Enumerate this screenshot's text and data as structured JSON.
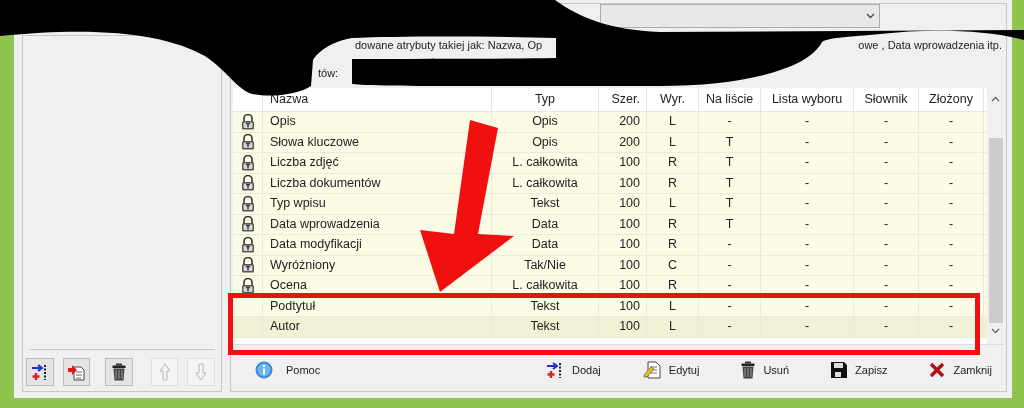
{
  "description_fragments": [
    "dowane atrybuty takiej jak: Nazwa, Op",
    "owe , Data wprowadzenia itp."
  ],
  "list_label": "tów:",
  "table": {
    "columns": [
      "Nazwa",
      "Typ",
      "Szer.",
      "Wyr.",
      "Na liście",
      "Lista wyboru",
      "Słownik",
      "Złożony"
    ],
    "rows": [
      {
        "locked": true,
        "selected": false,
        "cells": [
          "Opis",
          "Opis",
          "200",
          "L",
          "-",
          "-",
          "-",
          "-"
        ]
      },
      {
        "locked": true,
        "selected": false,
        "cells": [
          "Słowa kluczowe",
          "Opis",
          "200",
          "L",
          "T",
          "-",
          "-",
          "-"
        ]
      },
      {
        "locked": true,
        "selected": false,
        "cells": [
          "Liczba zdjęć",
          "L. całkowita",
          "100",
          "R",
          "T",
          "-",
          "-",
          "-"
        ]
      },
      {
        "locked": true,
        "selected": false,
        "cells": [
          "Liczba dokumentów",
          "L. całkowita",
          "100",
          "R",
          "T",
          "-",
          "-",
          "-"
        ]
      },
      {
        "locked": true,
        "selected": false,
        "cells": [
          "Typ wpisu",
          "Tekst",
          "100",
          "L",
          "T",
          "-",
          "-",
          "-"
        ]
      },
      {
        "locked": true,
        "selected": false,
        "cells": [
          "Data wprowadzenia",
          "Data",
          "100",
          "R",
          "T",
          "-",
          "-",
          "-"
        ]
      },
      {
        "locked": true,
        "selected": false,
        "cells": [
          "Data modyfikacji",
          "Data",
          "100",
          "R",
          "-",
          "-",
          "-",
          "-"
        ]
      },
      {
        "locked": true,
        "selected": false,
        "cells": [
          "Wyróżniony",
          "Tak/Nie",
          "100",
          "C",
          "-",
          "-",
          "-",
          "-"
        ]
      },
      {
        "locked": true,
        "selected": false,
        "cells": [
          "Ocena",
          "L. całkowita",
          "100",
          "R",
          "-",
          "-",
          "-",
          "-"
        ]
      },
      {
        "locked": false,
        "selected": false,
        "cells": [
          "Podtytuł",
          "Tekst",
          "100",
          "L",
          "-",
          "-",
          "-",
          "-"
        ]
      },
      {
        "locked": false,
        "selected": true,
        "cells": [
          "Autor",
          "Tekst",
          "100",
          "L",
          "-",
          "-",
          "-",
          "-"
        ]
      }
    ]
  },
  "left_toolbar": [
    {
      "kind": "add",
      "disabled": false
    },
    {
      "kind": "import",
      "disabled": false
    },
    {
      "kind": "delete",
      "disabled": false
    },
    {
      "kind": "up",
      "disabled": true
    },
    {
      "kind": "down",
      "disabled": true
    }
  ],
  "buttons": [
    {
      "kind": "help",
      "label": "Pomoc"
    },
    {
      "kind": "add",
      "label": "Dodaj"
    },
    {
      "kind": "edit",
      "label": "Edytuj"
    },
    {
      "kind": "delete",
      "label": "Usuń"
    },
    {
      "kind": "save",
      "label": "Zapisz"
    },
    {
      "kind": "close",
      "label": "Zamknij"
    }
  ]
}
